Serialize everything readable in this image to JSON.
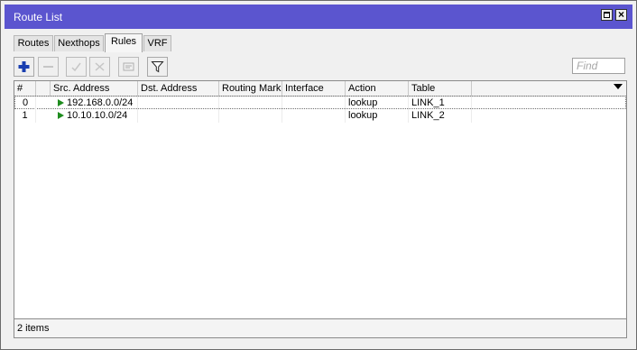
{
  "window": {
    "title": "Route List"
  },
  "tabs": [
    {
      "label": "Routes"
    },
    {
      "label": "Nexthops"
    },
    {
      "label": "Rules",
      "active": true
    },
    {
      "label": "VRF"
    }
  ],
  "toolbar": {
    "buttons": [
      {
        "icon": "plus-icon",
        "enabled": true
      },
      {
        "icon": "minus-icon",
        "enabled": false
      },
      {
        "icon": "check-icon",
        "enabled": false
      },
      {
        "icon": "cross-icon",
        "enabled": false
      },
      {
        "icon": "comment-icon",
        "enabled": false
      },
      {
        "icon": "filter-icon",
        "enabled": true
      }
    ],
    "find_placeholder": "Find"
  },
  "table": {
    "columns": [
      "#",
      "",
      "Src. Address",
      "Dst. Address",
      "Routing Mark",
      "Interface",
      "Action",
      "Table"
    ],
    "rows": [
      {
        "num": "0",
        "src": "192.168.0.0/24",
        "dst": "",
        "mark": "",
        "iface": "",
        "action": "lookup",
        "table": "LINK_1",
        "selected": true
      },
      {
        "num": "1",
        "src": "10.10.10.0/24",
        "dst": "",
        "mark": "",
        "iface": "",
        "action": "lookup",
        "table": "LINK_2",
        "selected": false
      }
    ]
  },
  "status": {
    "items": "2 items"
  },
  "colors": {
    "titlebar": "#5b55cf",
    "rule_flag": "#1e8c1e",
    "add_button": "#1a3fb0"
  }
}
